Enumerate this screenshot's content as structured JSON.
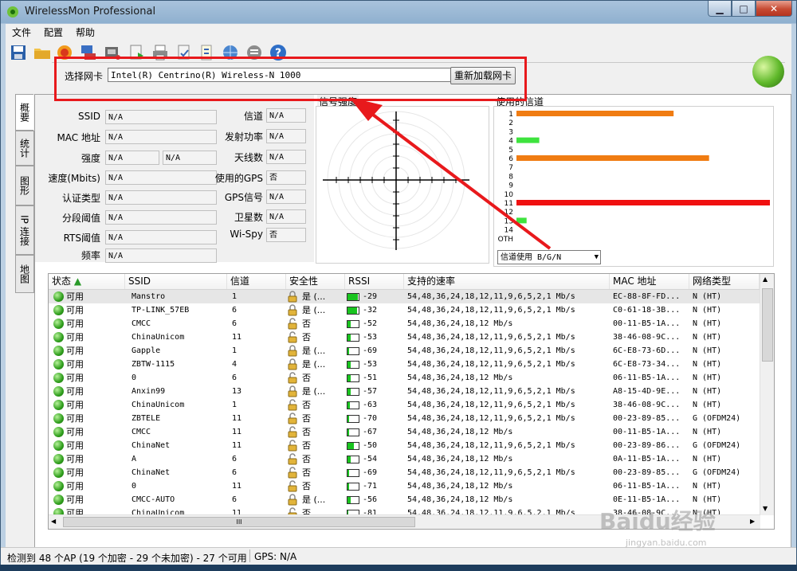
{
  "window": {
    "title": "WirelessMon Professional",
    "min": "▁",
    "max": "□",
    "close": "✕"
  },
  "menu": [
    "文件",
    "配置",
    "帮助"
  ],
  "adapter": {
    "label": "选择网卡",
    "selected": "Intel(R) Centrino(R) Wireless-N 1000",
    "reload_label": "重新加载网卡"
  },
  "tabs": [
    "概要",
    "统计",
    "图形",
    "IP 连接",
    "地图"
  ],
  "info": {
    "ssid_label": "SSID",
    "ssid": "N/A",
    "mac_label": "MAC 地址",
    "mac": "N/A",
    "strength_label": "强度",
    "strength1": "N/A",
    "strength2": "N/A",
    "speed_label": "速度(Mbits)",
    "speed": "N/A",
    "auth_label": "认证类型",
    "auth": "N/A",
    "frag_label": "分段阈值",
    "frag": "N/A",
    "rts_label": "RTS阈值",
    "rts": "N/A",
    "freq_label": "频率",
    "freq": "N/A",
    "channel_label": "信道",
    "channel": "N/A",
    "txpower_label": "发射功率",
    "txpower": "N/A",
    "antennas_label": "天线数",
    "antennas": "N/A",
    "gps_used_label": "使用的GPS",
    "gps_used": "否",
    "gps_signal_label": "GPS信号",
    "gps_signal": "N/A",
    "satellites_label": "卫星数",
    "satellites": "N/A",
    "wispy_label": "Wi-Spy",
    "wispy": "否"
  },
  "signal": {
    "label": "信号强度"
  },
  "channels": {
    "label": "使用的信道",
    "axis": [
      "1",
      "2",
      "3",
      "4",
      "5",
      "6",
      "7",
      "8",
      "9",
      "10",
      "11",
      "12",
      "13",
      "14",
      "OTH"
    ],
    "bars": [
      {
        "channel": "1",
        "value": 0.62,
        "color": "#f07c12"
      },
      {
        "channel": "4",
        "value": 0.09,
        "color": "#3ee33e"
      },
      {
        "channel": "6",
        "value": 0.76,
        "color": "#f07c12"
      },
      {
        "channel": "11",
        "value": 1.0,
        "color": "#f01010"
      },
      {
        "channel": "13",
        "value": 0.04,
        "color": "#3ee33e"
      }
    ],
    "select": "信道使用 B/G/N"
  },
  "table": {
    "columns": [
      "状态",
      "SSID",
      "信道",
      "安全性",
      "RSSI",
      "支持的速率",
      "MAC 地址",
      "网络类型"
    ],
    "rows": [
      {
        "status": "可用",
        "ssid": "Manstro",
        "channel": "1",
        "security": "是 (...",
        "rssi": "-29",
        "rates": "54,48,36,24,18,12,11,9,6,5,2,1 Mb/s",
        "mac": "EC-88-8F-FD...",
        "type": "N (HT)",
        "level": 0.9
      },
      {
        "status": "可用",
        "ssid": "TP-LINK_57EB",
        "channel": "6",
        "security": "是 (...",
        "rssi": "-32",
        "rates": "54,48,36,24,18,12,11,9,6,5,2,1 Mb/s",
        "mac": "C0-61-18-3B...",
        "type": "N (HT)",
        "level": 0.85
      },
      {
        "status": "可用",
        "ssid": "CMCC",
        "channel": "6",
        "security": "否",
        "rssi": "-52",
        "rates": "54,48,36,24,18,12 Mb/s",
        "mac": "00-11-B5-1A...",
        "type": "N (HT)",
        "level": 0.3
      },
      {
        "status": "可用",
        "ssid": "ChinaUnicom",
        "channel": "11",
        "security": "否",
        "rssi": "-53",
        "rates": "54,48,36,24,18,12,11,9,6,5,2,1 Mb/s",
        "mac": "38-46-08-9C...",
        "type": "N (HT)",
        "level": 0.3
      },
      {
        "status": "可用",
        "ssid": "Gapple",
        "channel": "1",
        "security": "是 (...",
        "rssi": "-69",
        "rates": "54,48,36,24,18,12,11,9,6,5,2,1 Mb/s",
        "mac": "6C-E8-73-6D...",
        "type": "N (HT)",
        "level": 0.15
      },
      {
        "status": "可用",
        "ssid": "ZBTW-1115",
        "channel": "4",
        "security": "是 (...",
        "rssi": "-53",
        "rates": "54,48,36,24,18,12,11,9,6,5,2,1 Mb/s",
        "mac": "6C-E8-73-34...",
        "type": "N (HT)",
        "level": 0.3
      },
      {
        "status": "可用",
        "ssid": "0",
        "channel": "6",
        "security": "否",
        "rssi": "-51",
        "rates": "54,48,36,24,18,12 Mb/s",
        "mac": "06-11-B5-1A...",
        "type": "N (HT)",
        "level": 0.3
      },
      {
        "status": "可用",
        "ssid": "Anxin99",
        "channel": "13",
        "security": "是 (...",
        "rssi": "-57",
        "rates": "54,48,36,24,18,12,11,9,6,5,2,1 Mb/s",
        "mac": "A8-15-4D-9E...",
        "type": "N (HT)",
        "level": 0.25
      },
      {
        "status": "可用",
        "ssid": "ChinaUnicom",
        "channel": "1",
        "security": "否",
        "rssi": "-63",
        "rates": "54,48,36,24,18,12,11,9,6,5,2,1 Mb/s",
        "mac": "38-46-08-9C...",
        "type": "N (HT)",
        "level": 0.2
      },
      {
        "status": "可用",
        "ssid": "ZBTELE",
        "channel": "11",
        "security": "否",
        "rssi": "-70",
        "rates": "54,48,36,24,18,12,11,9,6,5,2,1 Mb/s",
        "mac": "00-23-89-85...",
        "type": "G (OFDM24)",
        "level": 0.15
      },
      {
        "status": "可用",
        "ssid": "CMCC",
        "channel": "11",
        "security": "否",
        "rssi": "-67",
        "rates": "54,48,36,24,18,12 Mb/s",
        "mac": "00-11-B5-1A...",
        "type": "N (HT)",
        "level": 0.15
      },
      {
        "status": "可用",
        "ssid": "ChinaNet",
        "channel": "11",
        "security": "否",
        "rssi": "-50",
        "rates": "54,48,36,24,18,12,11,9,6,5,2,1 Mb/s",
        "mac": "00-23-89-86...",
        "type": "G (OFDM24)",
        "level": 0.6
      },
      {
        "status": "可用",
        "ssid": "A",
        "channel": "6",
        "security": "否",
        "rssi": "-54",
        "rates": "54,48,36,24,18,12 Mb/s",
        "mac": "0A-11-B5-1A...",
        "type": "N (HT)",
        "level": 0.3
      },
      {
        "status": "可用",
        "ssid": "ChinaNet",
        "channel": "6",
        "security": "否",
        "rssi": "-69",
        "rates": "54,48,36,24,18,12,11,9,6,5,2,1 Mb/s",
        "mac": "00-23-89-85...",
        "type": "G (OFDM24)",
        "level": 0.15
      },
      {
        "status": "可用",
        "ssid": "0",
        "channel": "11",
        "security": "否",
        "rssi": "-71",
        "rates": "54,48,36,24,18,12 Mb/s",
        "mac": "06-11-B5-1A...",
        "type": "N (HT)",
        "level": 0.15
      },
      {
        "status": "可用",
        "ssid": "CMCC-AUTO",
        "channel": "6",
        "security": "是 (...",
        "rssi": "-56",
        "rates": "54,48,36,24,18,12 Mb/s",
        "mac": "0E-11-B5-1A...",
        "type": "N (HT)",
        "level": 0.25
      },
      {
        "status": "可用",
        "ssid": "ChinaUnicom",
        "channel": "11",
        "security": "否",
        "rssi": "-81",
        "rates": "54,48,36,24,18,12,11,9,6,5,2,1 Mb/s",
        "mac": "38-46-08-9C...",
        "type": "N (HT)",
        "level": 0.05
      }
    ]
  },
  "scroll": {
    "hthumb": "III"
  },
  "status": {
    "summary": "检测到 48 个AP (19 个加密 - 29 个未加密) - 27 个可用",
    "gps": "GPS: N/A"
  },
  "watermark": {
    "main": "Baidu经验",
    "sub": "jingyan.baidu.com"
  }
}
